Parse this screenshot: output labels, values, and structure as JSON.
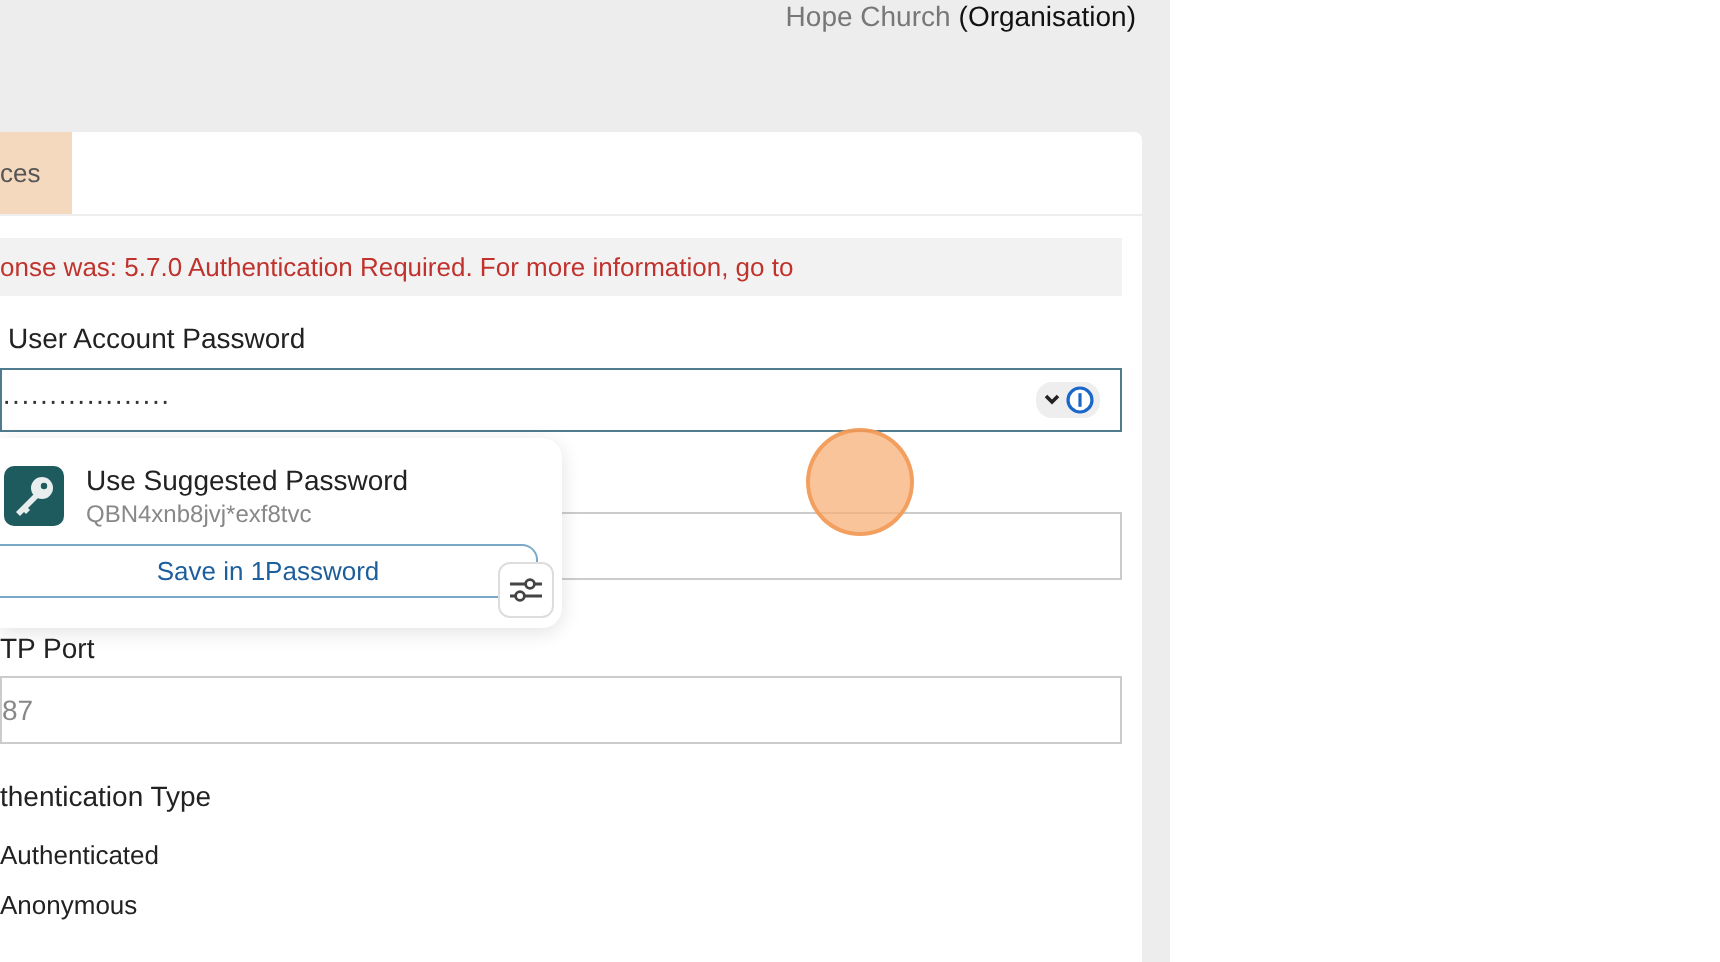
{
  "header": {
    "organisation_name": "Hope Church",
    "organisation_type": "(Organisation)"
  },
  "tabs": [
    {
      "label": "ces",
      "selected": true
    }
  ],
  "error_message": "onse was: 5.7.0 Authentication Required. For more information, go to",
  "form": {
    "password": {
      "label": "User Account Password",
      "value": "··················"
    },
    "port": {
      "label": "TP Port",
      "placeholder": "87"
    },
    "auth": {
      "label": "thentication Type",
      "options": [
        {
          "label": "Authenticated"
        },
        {
          "label": "Anonymous"
        }
      ]
    }
  },
  "password_popup": {
    "title": "Use Suggested Password",
    "suggestion": "QBN4xnb8jvj*exf8tvc",
    "save_button": "Save in 1Password"
  }
}
